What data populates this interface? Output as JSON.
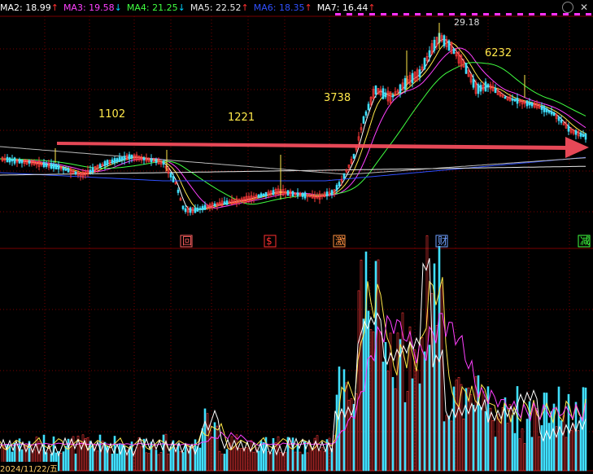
{
  "legend": [
    {
      "label": "MA2:",
      "value": "18.99",
      "arrow": "up",
      "color": "#ffffff"
    },
    {
      "label": "MA3:",
      "value": "19.58",
      "arrow": "down",
      "color": "#ff40ff"
    },
    {
      "label": "MA4:",
      "value": "21.25",
      "arrow": "down",
      "color": "#40ff40"
    },
    {
      "label": "MA5:",
      "value": "22.52",
      "arrow": "up",
      "color": "#e8e8e8"
    },
    {
      "label": "MA6:",
      "value": "18.35",
      "arrow": "up",
      "color": "#3050ff"
    },
    {
      "label": "MA7:",
      "value": "16.44",
      "arrow": "up",
      "color": "#ffffff"
    }
  ],
  "annotations": {
    "high_price": "29.18",
    "peaks": [
      "1102",
      "1221",
      "3738",
      "6232"
    ]
  },
  "events": [
    {
      "label": "回",
      "color": "#ff6060"
    },
    {
      "label": "$",
      "color": "#ff3030"
    },
    {
      "label": "激",
      "color": "#ff9040"
    },
    {
      "label": "财",
      "color": "#70a0ff"
    },
    {
      "label": "减",
      "color": "#40ff40"
    }
  ],
  "date_label": "2024/11/22/五",
  "colors": {
    "up": "#ff3a3a",
    "down": "#40e0ff",
    "grid": "#8b0000",
    "trend_arrow": "#ff5060"
  }
}
